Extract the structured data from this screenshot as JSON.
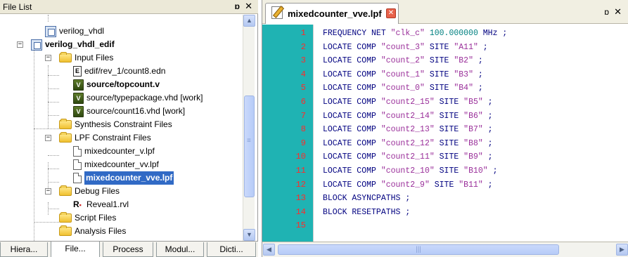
{
  "file_list": {
    "title": "File List",
    "pin": "ɒ",
    "close": "✕",
    "tree": [
      {
        "label": "verilog_vhdl",
        "icon": "project-icon",
        "bold": false
      },
      {
        "label": "verilog_vhdl_edif",
        "icon": "project-icon",
        "bold": true
      },
      {
        "label": "Input Files",
        "icon": "folder-icon"
      },
      {
        "label": "edif/rev_1/count8.edn",
        "icon": "edn-file-icon"
      },
      {
        "label": "source/topcount.v",
        "icon": "verilog-file-icon",
        "bold": true
      },
      {
        "label": "source/typepackage.vhd [work]",
        "icon": "vhdl-file-icon"
      },
      {
        "label": "source/count16.vhd [work]",
        "icon": "vhdl-file-icon"
      },
      {
        "label": "Synthesis Constraint Files",
        "icon": "folder-icon"
      },
      {
        "label": "LPF Constraint Files",
        "icon": "folder-icon"
      },
      {
        "label": "mixedcounter_v.lpf",
        "icon": "file-icon"
      },
      {
        "label": "mixedcounter_vv.lpf",
        "icon": "file-icon"
      },
      {
        "label": "mixedcounter_vve.lpf",
        "icon": "file-icon",
        "selected": true
      },
      {
        "label": "Debug Files",
        "icon": "folder-icon"
      },
      {
        "label": "Reveal1.rvl",
        "icon": "reveal-file-icon"
      },
      {
        "label": "Script Files",
        "icon": "folder-icon"
      },
      {
        "label": "Analysis Files",
        "icon": "folder-icon"
      }
    ],
    "tabs": [
      "Hiera...",
      "File...",
      "Process",
      "Modul...",
      "Dicti..."
    ]
  },
  "editor": {
    "tab_title": "mixedcounter_vve.lpf",
    "pin": "ɒ",
    "close": "✕",
    "line_numbers": [
      "1",
      "2",
      "3",
      "4",
      "5",
      "6",
      "7",
      "8",
      "9",
      "10",
      "11",
      "12",
      "13",
      "14",
      "15"
    ],
    "lines": [
      [
        {
          "t": "FREQUENCY NET ",
          "c": ""
        },
        {
          "t": "\"clk_c\"",
          "c": "s"
        },
        {
          "t": " ",
          "c": ""
        },
        {
          "t": "100.000000",
          "c": "n"
        },
        {
          "t": " MHz ;",
          "c": ""
        }
      ],
      [
        {
          "t": "LOCATE COMP ",
          "c": ""
        },
        {
          "t": "\"count_3\"",
          "c": "s"
        },
        {
          "t": " SITE ",
          "c": ""
        },
        {
          "t": "\"A11\"",
          "c": "s"
        },
        {
          "t": " ;",
          "c": ""
        }
      ],
      [
        {
          "t": "LOCATE COMP ",
          "c": ""
        },
        {
          "t": "\"count_2\"",
          "c": "s"
        },
        {
          "t": " SITE ",
          "c": ""
        },
        {
          "t": "\"B2\"",
          "c": "s"
        },
        {
          "t": " ;",
          "c": ""
        }
      ],
      [
        {
          "t": "LOCATE COMP ",
          "c": ""
        },
        {
          "t": "\"count_1\"",
          "c": "s"
        },
        {
          "t": " SITE ",
          "c": ""
        },
        {
          "t": "\"B3\"",
          "c": "s"
        },
        {
          "t": " ;",
          "c": ""
        }
      ],
      [
        {
          "t": "LOCATE COMP ",
          "c": ""
        },
        {
          "t": "\"count_0\"",
          "c": "s"
        },
        {
          "t": " SITE ",
          "c": ""
        },
        {
          "t": "\"B4\"",
          "c": "s"
        },
        {
          "t": " ;",
          "c": ""
        }
      ],
      [
        {
          "t": "LOCATE COMP ",
          "c": ""
        },
        {
          "t": "\"count2_15\"",
          "c": "s"
        },
        {
          "t": " SITE ",
          "c": ""
        },
        {
          "t": "\"B5\"",
          "c": "s"
        },
        {
          "t": " ;",
          "c": ""
        }
      ],
      [
        {
          "t": "LOCATE COMP ",
          "c": ""
        },
        {
          "t": "\"count2_14\"",
          "c": "s"
        },
        {
          "t": " SITE ",
          "c": ""
        },
        {
          "t": "\"B6\"",
          "c": "s"
        },
        {
          "t": " ;",
          "c": ""
        }
      ],
      [
        {
          "t": "LOCATE COMP ",
          "c": ""
        },
        {
          "t": "\"count2_13\"",
          "c": "s"
        },
        {
          "t": " SITE ",
          "c": ""
        },
        {
          "t": "\"B7\"",
          "c": "s"
        },
        {
          "t": " ;",
          "c": ""
        }
      ],
      [
        {
          "t": "LOCATE COMP ",
          "c": ""
        },
        {
          "t": "\"count2_12\"",
          "c": "s"
        },
        {
          "t": " SITE ",
          "c": ""
        },
        {
          "t": "\"B8\"",
          "c": "s"
        },
        {
          "t": " ;",
          "c": ""
        }
      ],
      [
        {
          "t": "LOCATE COMP ",
          "c": ""
        },
        {
          "t": "\"count2_11\"",
          "c": "s"
        },
        {
          "t": " SITE ",
          "c": ""
        },
        {
          "t": "\"B9\"",
          "c": "s"
        },
        {
          "t": " ;",
          "c": ""
        }
      ],
      [
        {
          "t": "LOCATE COMP ",
          "c": ""
        },
        {
          "t": "\"count2_10\"",
          "c": "s"
        },
        {
          "t": " SITE ",
          "c": ""
        },
        {
          "t": "\"B10\"",
          "c": "s"
        },
        {
          "t": " ;",
          "c": ""
        }
      ],
      [
        {
          "t": "LOCATE COMP ",
          "c": ""
        },
        {
          "t": "\"count2_9\"",
          "c": "s"
        },
        {
          "t": " SITE ",
          "c": ""
        },
        {
          "t": "\"B11\"",
          "c": "s"
        },
        {
          "t": " ;",
          "c": ""
        }
      ],
      [
        {
          "t": "BLOCK ASYNCPATHS ;",
          "c": ""
        }
      ],
      [
        {
          "t": "BLOCK RESETPATHS ;",
          "c": ""
        }
      ],
      [
        {
          "t": "",
          "c": ""
        }
      ]
    ]
  },
  "colors": {
    "gutter_bg": "#1fb3b3",
    "line_number": "#ff2a2a",
    "code_keyword": "#000080",
    "code_string": "#9a2f9a",
    "code_number": "#008080",
    "selection": "#316ac5"
  }
}
